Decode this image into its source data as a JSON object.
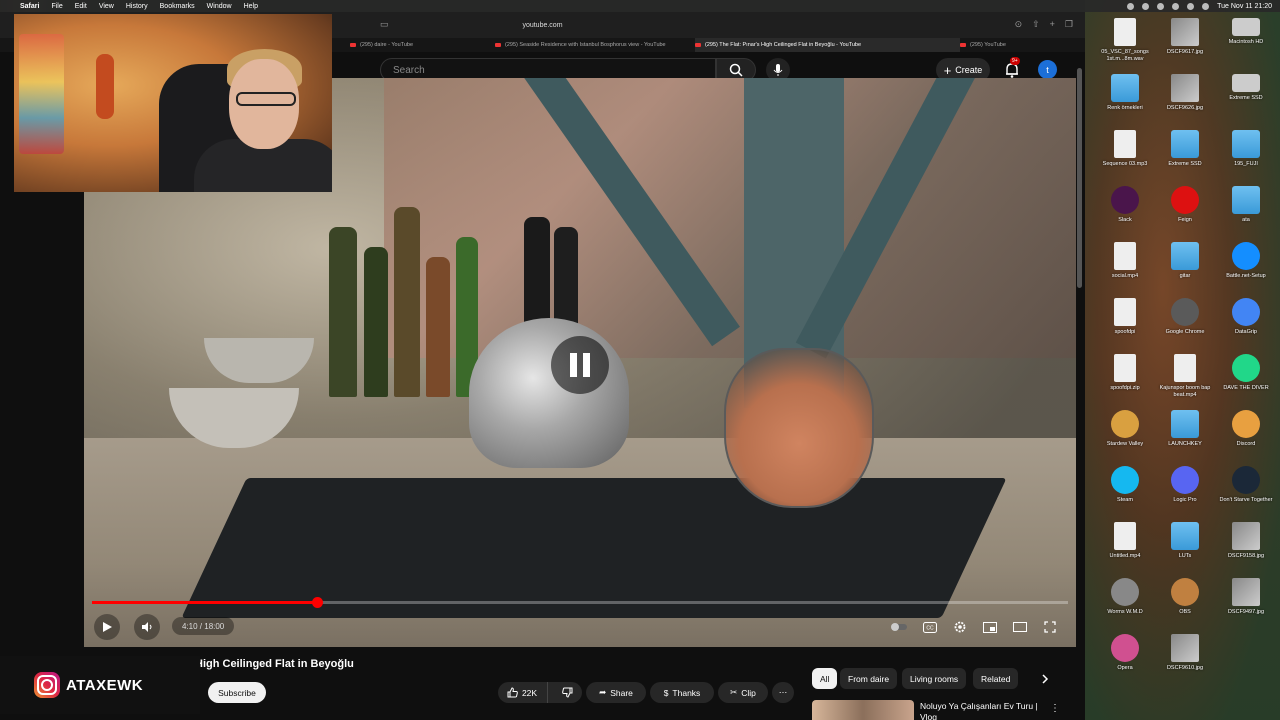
{
  "menubar": {
    "apple": "",
    "app": "Safari",
    "items": [
      "File",
      "Edit",
      "View",
      "History",
      "Bookmarks",
      "Window",
      "Help"
    ],
    "clock": "Tue Nov 11  21:20"
  },
  "browser": {
    "url": "youtube.com",
    "tabs": [
      {
        "label": "(295) daire - YouTube",
        "active": false
      },
      {
        "label": "(295) Seaside Residence with Istanbul Bosphorus view - YouTube",
        "active": false
      },
      {
        "label": "(295) The Flat: Pınar's High Ceilinged Flat in Beyoğlu - YouTube",
        "active": true
      },
      {
        "label": "(295) YouTube",
        "active": false
      }
    ]
  },
  "header": {
    "search_placeholder": "Search",
    "create_label": "Create",
    "notification_badge": "9+",
    "avatar_letter": "t"
  },
  "video": {
    "time": "4:10 / 18:00",
    "progress": 0.2306,
    "title": "High Ceilinged Flat in Beyoğlu"
  },
  "channel": {
    "name": "ATAXEWK",
    "subscribe_label": "Subscribe"
  },
  "actions": {
    "likes": "22K",
    "share": "Share",
    "thanks": "Thanks",
    "clip": "Clip"
  },
  "chips": [
    {
      "label": "All",
      "active": true
    },
    {
      "label": "From daire",
      "active": false
    },
    {
      "label": "Living rooms",
      "active": false
    },
    {
      "label": "Related",
      "active": false
    }
  ],
  "recommendation": {
    "title": "Noluyo Ya Çalışanları Ev Turu | Vlog"
  },
  "desktop_icons": [
    {
      "label": "05_VSC_87_songs 1st.m...8m.wav",
      "kind": "file"
    },
    {
      "label": "DSCF9617.jpg",
      "kind": "img"
    },
    {
      "label": "Macintosh HD",
      "kind": "drive"
    },
    {
      "label": "Renk örnekleri",
      "kind": "folder"
    },
    {
      "label": "DSCF9626.jpg",
      "kind": "img"
    },
    {
      "label": "Extreme SSD",
      "kind": "drive"
    },
    {
      "label": "Sequence 03.mp3",
      "kind": "file"
    },
    {
      "label": "Extreme SSD",
      "kind": "folder"
    },
    {
      "label": "195_FUJI",
      "kind": "folder"
    },
    {
      "label": "Slack",
      "kind": "app"
    },
    {
      "label": "Feign",
      "kind": "app"
    },
    {
      "label": "ata",
      "kind": "folder"
    },
    {
      "label": "social.mp4",
      "kind": "file"
    },
    {
      "label": "gitar",
      "kind": "folder"
    },
    {
      "label": "Battle.net-Setup",
      "kind": "app"
    },
    {
      "label": "spoofdpi",
      "kind": "file"
    },
    {
      "label": "Google Chrome",
      "kind": "app"
    },
    {
      "label": "DataGrip",
      "kind": "app"
    },
    {
      "label": "spoofdpi.zip",
      "kind": "file"
    },
    {
      "label": "Kajunspor boom bap beat.mp4",
      "kind": "file"
    },
    {
      "label": "DAVE THE DIVER",
      "kind": "app"
    },
    {
      "label": "Stardew Valley",
      "kind": "app"
    },
    {
      "label": "LAUNCHKEY",
      "kind": "folder"
    },
    {
      "label": "Discord",
      "kind": "app"
    },
    {
      "label": "Steam",
      "kind": "app"
    },
    {
      "label": "Logic Pro",
      "kind": "app"
    },
    {
      "label": "Don't Starve Together",
      "kind": "app"
    },
    {
      "label": "Untitled.mp4",
      "kind": "file"
    },
    {
      "label": "LUTs",
      "kind": "folder"
    },
    {
      "label": "DSCF9158.jpg",
      "kind": "img"
    },
    {
      "label": "Worms W.M.D",
      "kind": "app"
    },
    {
      "label": "OBS",
      "kind": "app"
    },
    {
      "label": "DSCF9497.jpg",
      "kind": "img"
    },
    {
      "label": "Opera",
      "kind": "app"
    },
    {
      "label": "DSCF9610.jpg",
      "kind": "img"
    }
  ],
  "colors": {
    "yt_red": "#ff0000",
    "chip_active_bg": "#f1f1f1",
    "pill_bg": "#272727"
  }
}
